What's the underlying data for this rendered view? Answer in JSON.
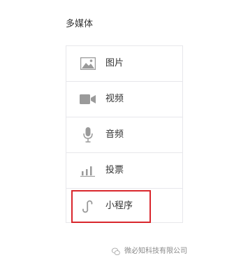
{
  "section": {
    "title": "多媒体"
  },
  "media_items": [
    {
      "label": "图片",
      "icon": "image-icon"
    },
    {
      "label": "视频",
      "icon": "video-camera-icon"
    },
    {
      "label": "音频",
      "icon": "microphone-icon"
    },
    {
      "label": "投票",
      "icon": "bar-chart-icon"
    },
    {
      "label": "小程序",
      "icon": "mini-program-link-icon"
    }
  ],
  "highlight": {
    "target": "小程序",
    "color": "#d9262c"
  },
  "watermark": {
    "text": "微必知科技有限公司",
    "icon": "wechat-logo-icon"
  },
  "colors": {
    "icon_gray": "#9a9a9a",
    "border": "#e7e7eb",
    "text": "#333333"
  }
}
